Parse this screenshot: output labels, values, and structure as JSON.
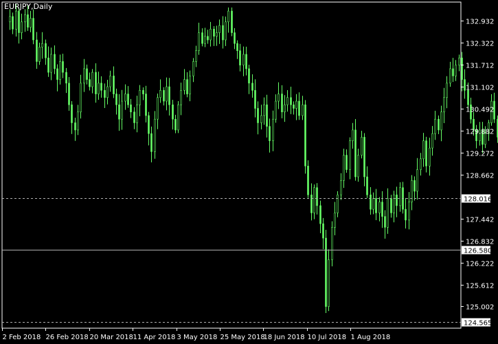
{
  "symbol_label": "EURJPY,Daily",
  "colors": {
    "background": "#000000",
    "frame": "#ffffff",
    "candle": "#66ff66",
    "tick_text": "#ffffff",
    "level_line": "#b0b0b0",
    "badge_text": "#000000",
    "badge_bg": "#ffffff"
  },
  "chart_data": {
    "type": "candlestick",
    "title": "",
    "xlabel": "",
    "ylabel": "",
    "ylim": [
      124.4,
      133.45
    ],
    "y_ticks": [
      "132.932",
      "132.322",
      "131.712",
      "131.102",
      "130.492",
      "129.882",
      "129.272",
      "128.662",
      "127.442",
      "126.832",
      "126.222",
      "125.612",
      "125.002"
    ],
    "x_ticks": [
      "2 Feb 2018",
      "26 Feb 2018",
      "20 Mar 2018",
      "11 Apr 2018",
      "3 May 2018",
      "25 May 2018",
      "18 Jun 2018",
      "10 Jul 2018",
      "1 Aug 2018"
    ],
    "levels": [
      {
        "value": 128.016,
        "label": "128.016",
        "style": "dashed"
      },
      {
        "value": 126.58,
        "label": "126.580",
        "style": "solid"
      },
      {
        "value": 124.565,
        "label": "124.565",
        "style": "dashed"
      }
    ],
    "closes": [
      133.05,
      132.7,
      133.2,
      132.6,
      132.9,
      133.1,
      132.75,
      133.0,
      132.4,
      131.8,
      132.2,
      132.3,
      131.9,
      131.5,
      132.0,
      131.6,
      131.3,
      131.8,
      131.5,
      131.2,
      130.6,
      130.1,
      129.9,
      130.4,
      131.2,
      131.6,
      131.3,
      131.1,
      131.5,
      130.9,
      131.2,
      131.0,
      130.8,
      131.1,
      131.4,
      130.9,
      130.6,
      130.2,
      130.7,
      130.9,
      130.6,
      130.4,
      130.1,
      130.6,
      131.0,
      130.9,
      130.3,
      129.8,
      129.3,
      130.2,
      130.8,
      131.0,
      130.7,
      131.1,
      130.6,
      130.2,
      129.9,
      130.6,
      131.0,
      131.3,
      130.9,
      131.4,
      131.8,
      132.1,
      132.6,
      132.3,
      132.5,
      132.4,
      132.7,
      132.5,
      132.6,
      132.8,
      132.4,
      132.9,
      133.2,
      132.6,
      132.3,
      132.1,
      131.7,
      132.0,
      131.6,
      131.2,
      131.0,
      130.5,
      130.1,
      130.3,
      130.6,
      130.0,
      129.6,
      130.2,
      130.7,
      130.9,
      130.4,
      130.6,
      130.8,
      130.6,
      130.5,
      130.7,
      130.3,
      130.6,
      128.9,
      128.1,
      127.6,
      128.3,
      127.8,
      127.3,
      126.9,
      125.0,
      126.3,
      127.2,
      127.6,
      128.1,
      128.5,
      129.2,
      128.8,
      129.6,
      129.9,
      128.6,
      129.2,
      129.7,
      128.6,
      128.1,
      127.7,
      128.0,
      127.6,
      127.9,
      127.5,
      127.2,
      128.0,
      127.6,
      128.1,
      127.8,
      128.3,
      127.7,
      127.4,
      127.9,
      128.5,
      128.2,
      128.8,
      129.1,
      129.6,
      128.9,
      129.4,
      129.8,
      130.2,
      129.9,
      130.4,
      130.8,
      131.2,
      131.6,
      131.4,
      131.7,
      131.9,
      131.3,
      131.0,
      130.6,
      130.2,
      129.9,
      129.6,
      129.9,
      129.5,
      129.8,
      130.1,
      130.7,
      130.2,
      129.7,
      129.3,
      128.9,
      128.7,
      128.9,
      128.6,
      129.1,
      128.8,
      128.0,
      126.1
    ]
  }
}
